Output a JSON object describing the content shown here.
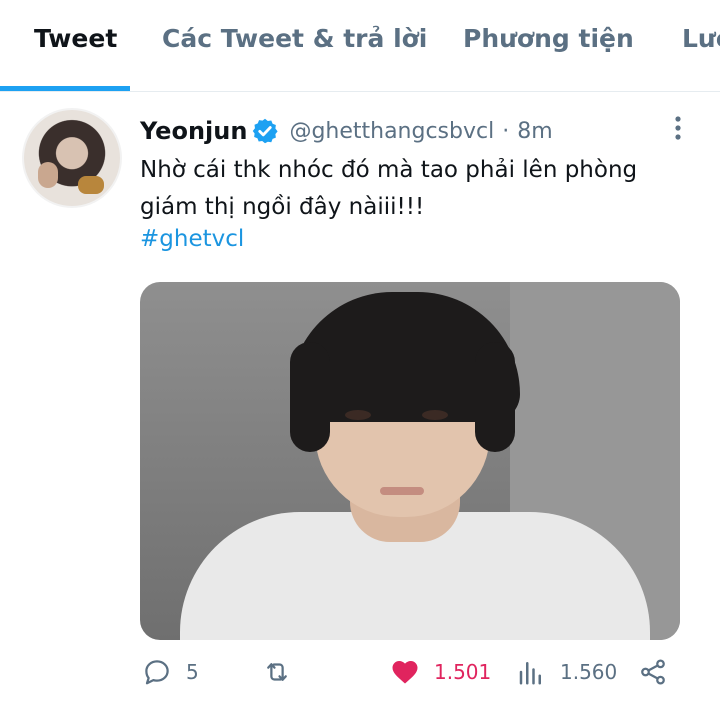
{
  "tabs": [
    {
      "label": "Tweet",
      "active": true
    },
    {
      "label": "Các Tweet & trả lời",
      "active": false
    },
    {
      "label": "Phương tiện",
      "active": false
    },
    {
      "label": "Lượ",
      "active": false
    }
  ],
  "tweet": {
    "display_name": "Yeonjun",
    "verified": true,
    "handle": "@ghetthangcsbvcl",
    "separator": "·",
    "time": "8m",
    "text": "Nhờ cái thk nhóc đó mà tao phải lên phòng giám thị ngồi đây nàiii!!!",
    "hashtag": "#ghetvcl",
    "media_icon": "photo-of-person"
  },
  "actions": {
    "reply_count": "5",
    "retweet_count": "",
    "like_count": "1.501",
    "views_count": "1.560",
    "liked": true
  },
  "colors": {
    "accent": "#1da1f2",
    "like": "#e0245e",
    "muted": "#5b7083",
    "text": "#0f1419",
    "hashtag": "#1b95e0"
  }
}
